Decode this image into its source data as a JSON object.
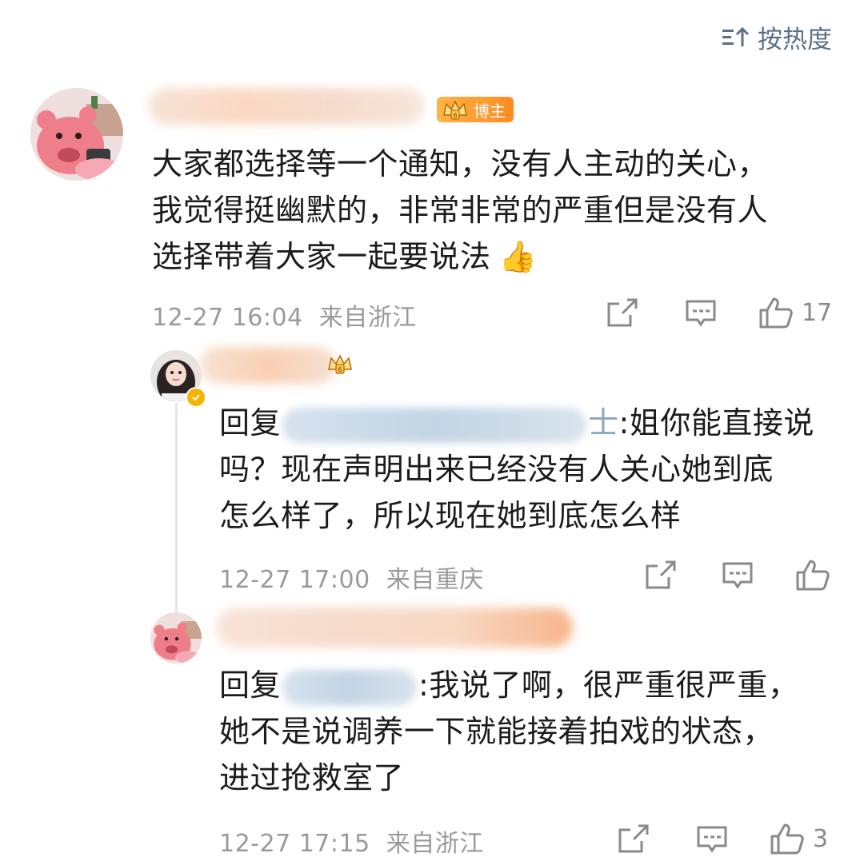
{
  "sort": {
    "label": "按热度",
    "icon": "sort-icon"
  },
  "comments": [
    {
      "badge": "博主",
      "text_lines": [
        "大家都选择等一个通知，没有人主动的关心，",
        "我觉得挺幽默的，非常非常的严重但是没有人",
        "选择带着大家一起要说法"
      ],
      "emoji": "👍",
      "time": "12-27 16:04",
      "location": "来自浙江",
      "likes": "17"
    },
    {
      "reply_prefix": "回复",
      "reply_suffix": ":姐你能直接说",
      "reply_target_tail": "士",
      "text_lines": [
        "吗？现在声明出来已经没有人关心她到底",
        "怎么样了，所以现在她到底怎么样"
      ],
      "time": "12-27 17:00",
      "location": "来自重庆",
      "likes": ""
    },
    {
      "reply_prefix": "回复",
      "reply_suffix": ":我说了啊，很严重很严重，",
      "text_lines": [
        "她不是说调养一下就能接着拍戏的状态，",
        "进过抢救室了"
      ],
      "time": "12-27 17:15",
      "location": "来自浙江",
      "likes": "3"
    }
  ],
  "colors": {
    "sort_text": "#5b7088",
    "meta_text": "#9a9a9a",
    "badge_orange": "#ff8a1f",
    "avatar_pink": "#ee7f8a",
    "verify_gold": "#f5b400"
  }
}
